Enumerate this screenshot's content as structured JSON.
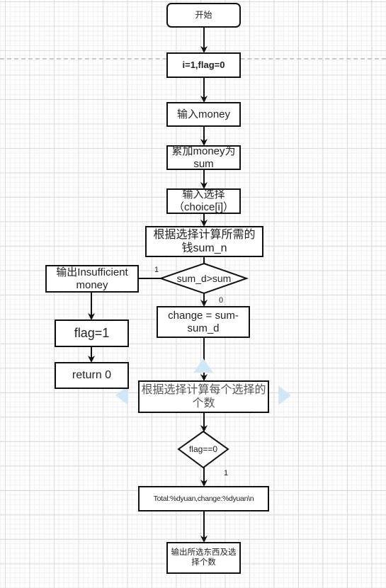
{
  "flowchart": {
    "nodes": {
      "start": "开始",
      "init": "i=1,flag=0",
      "input_money": "输入money",
      "accumulate": "累加money为sum",
      "input_choice": "输入选择（choice[i]）",
      "calc_needed": "根据选择计算所需的钱sum_n",
      "decision_sum": "sum_d>sum",
      "insufficient": "输出Insufficient money",
      "set_flag": "flag=1",
      "return_zero": "return 0",
      "change": "change = sum-sum_d",
      "calc_count": "根据选择计算每个选择的个数",
      "decision_flag": "flag==0",
      "print_total": "Total:%dyuan,change:%dyuan\\n",
      "output_items": "输出所选东西及选择个数"
    },
    "edge_labels": {
      "sum_true": "1",
      "sum_false": "0",
      "flag_true": "1"
    },
    "selected_node": "calc_count",
    "colors": {
      "stroke": "#111111",
      "selection_hint": "#cfe8f7",
      "grid": "#dcdcdc"
    }
  }
}
